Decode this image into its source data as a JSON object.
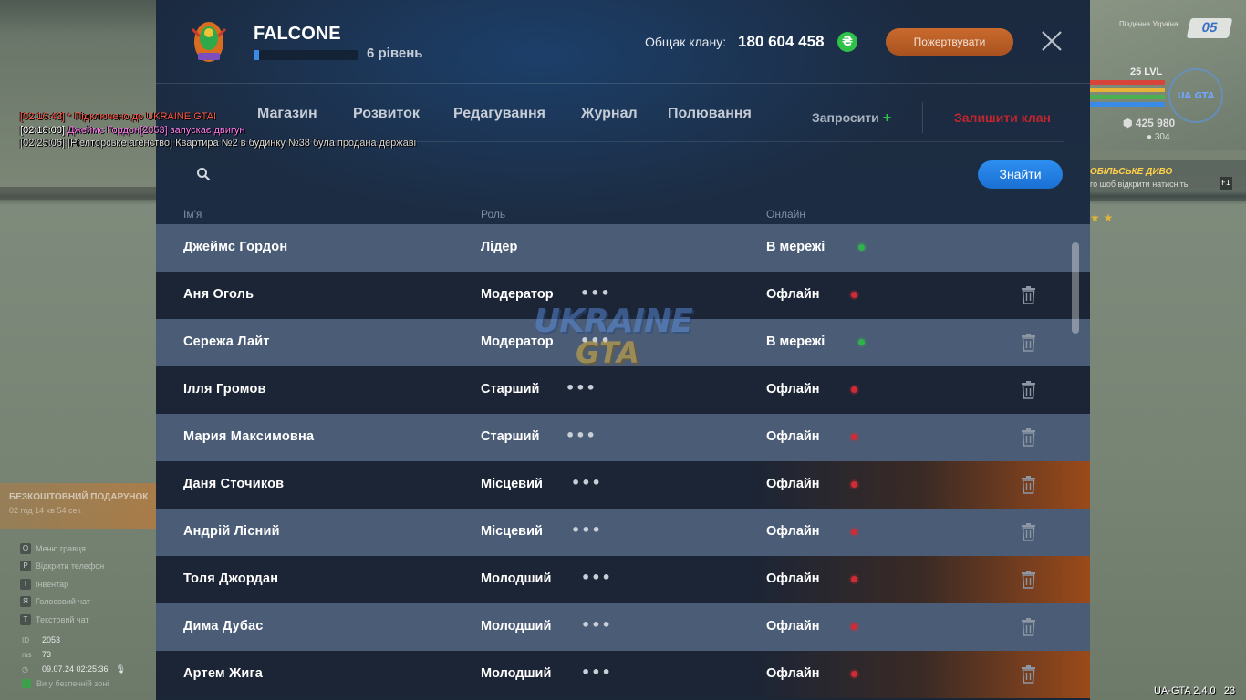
{
  "chat": [
    {
      "time": "[02:16:43]",
      "text": "* Підключено до UKRAINE GTA!"
    },
    {
      "time": "[02:18:00]",
      "text": "Джеймс Гордон[2053] запускає двигун"
    },
    {
      "time": "[02:25:06]",
      "text": "[Ріелторське агенство] Квартира №2 в будинку №38 була продана державі"
    }
  ],
  "hud": {
    "region": "Південна Україна",
    "badge_number": "05",
    "level": "25 LVL",
    "money": "425 980",
    "coins": "304",
    "quest_title": "ОБІЛЬСЬКЕ ДИВО",
    "quest_sub": "го щоб відкрити натисніть",
    "quest_key": "F1",
    "gift_title": "БЕЗКОШТОВНИЙ ПОДАРУНОК",
    "gift_sub": "02 год 14 хв 54 сек",
    "hotkeys": [
      {
        "key": "O",
        "label": "Меню гравця"
      },
      {
        "key": "P",
        "label": "Відкрити телефон"
      },
      {
        "key": "I",
        "label": "Інвентар"
      },
      {
        "key": "Я",
        "label": "Голосовий чат"
      },
      {
        "key": "T",
        "label": "Текстовий чат"
      }
    ],
    "id_label": "ID",
    "id_value": "2053",
    "ms_label": "ms",
    "ms_value": "73",
    "datetime": "09.07.24 02:25:36",
    "safe_zone": "Ви у безпечній зоні",
    "version": "UA-GTA 2.4.0",
    "version_tail": "23"
  },
  "clan": {
    "name": "FALCONE",
    "level_text": "6 рівень",
    "level_progress": 0.05,
    "bank_label": "Общак клану:",
    "bank_value": "180 604 458",
    "currency_symbol": "₴",
    "donate_label": "Пожертвувати"
  },
  "tabs": [
    "Магазин",
    "Розвиток",
    "Редагування",
    "Журнал",
    "Полювання"
  ],
  "invite_label": "Запросити",
  "leave_label": "Залишити клан",
  "search": {
    "placeholder": "",
    "button": "Знайти"
  },
  "columns": {
    "name": "Ім'я",
    "role": "Роль",
    "online": "Онлайн"
  },
  "members": [
    {
      "name": "Джеймс Гордон",
      "role": "Лідер",
      "status": "В мережі",
      "online": true
    },
    {
      "name": "Аня Оголь",
      "role": "Модератор",
      "status": "Офлайн",
      "online": false
    },
    {
      "name": "Сережа Лайт",
      "role": "Модератор",
      "status": "В мережі",
      "online": true
    },
    {
      "name": "Ілля Громов",
      "role": "Старший",
      "status": "Офлайн",
      "online": false
    },
    {
      "name": "Мария Максимовна",
      "role": "Старший",
      "status": "Офлайн",
      "online": false
    },
    {
      "name": "Даня Сточиков",
      "role": "Місцевий",
      "status": "Офлайн",
      "online": false
    },
    {
      "name": "Андрій Лісний",
      "role": "Місцевий",
      "status": "Офлайн",
      "online": false
    },
    {
      "name": "Толя Джордан",
      "role": "Молодший",
      "status": "Офлайн",
      "online": false
    },
    {
      "name": "Дима Дубас",
      "role": "Молодший",
      "status": "Офлайн",
      "online": false
    },
    {
      "name": "Артем Жига",
      "role": "Молодший",
      "status": "Офлайн",
      "online": false
    }
  ],
  "colors": {
    "accent": "#2c8ff0",
    "online": "#2fb44c",
    "offline": "#d42a35",
    "leave": "#c0262d",
    "donate": "#c96a2e"
  },
  "icons": {
    "search": "search-icon",
    "close": "close-icon",
    "trash": "trash-icon",
    "more": "more-dots-icon"
  },
  "watermark": {
    "line1": "UKRAINE",
    "line2": "GTA"
  }
}
